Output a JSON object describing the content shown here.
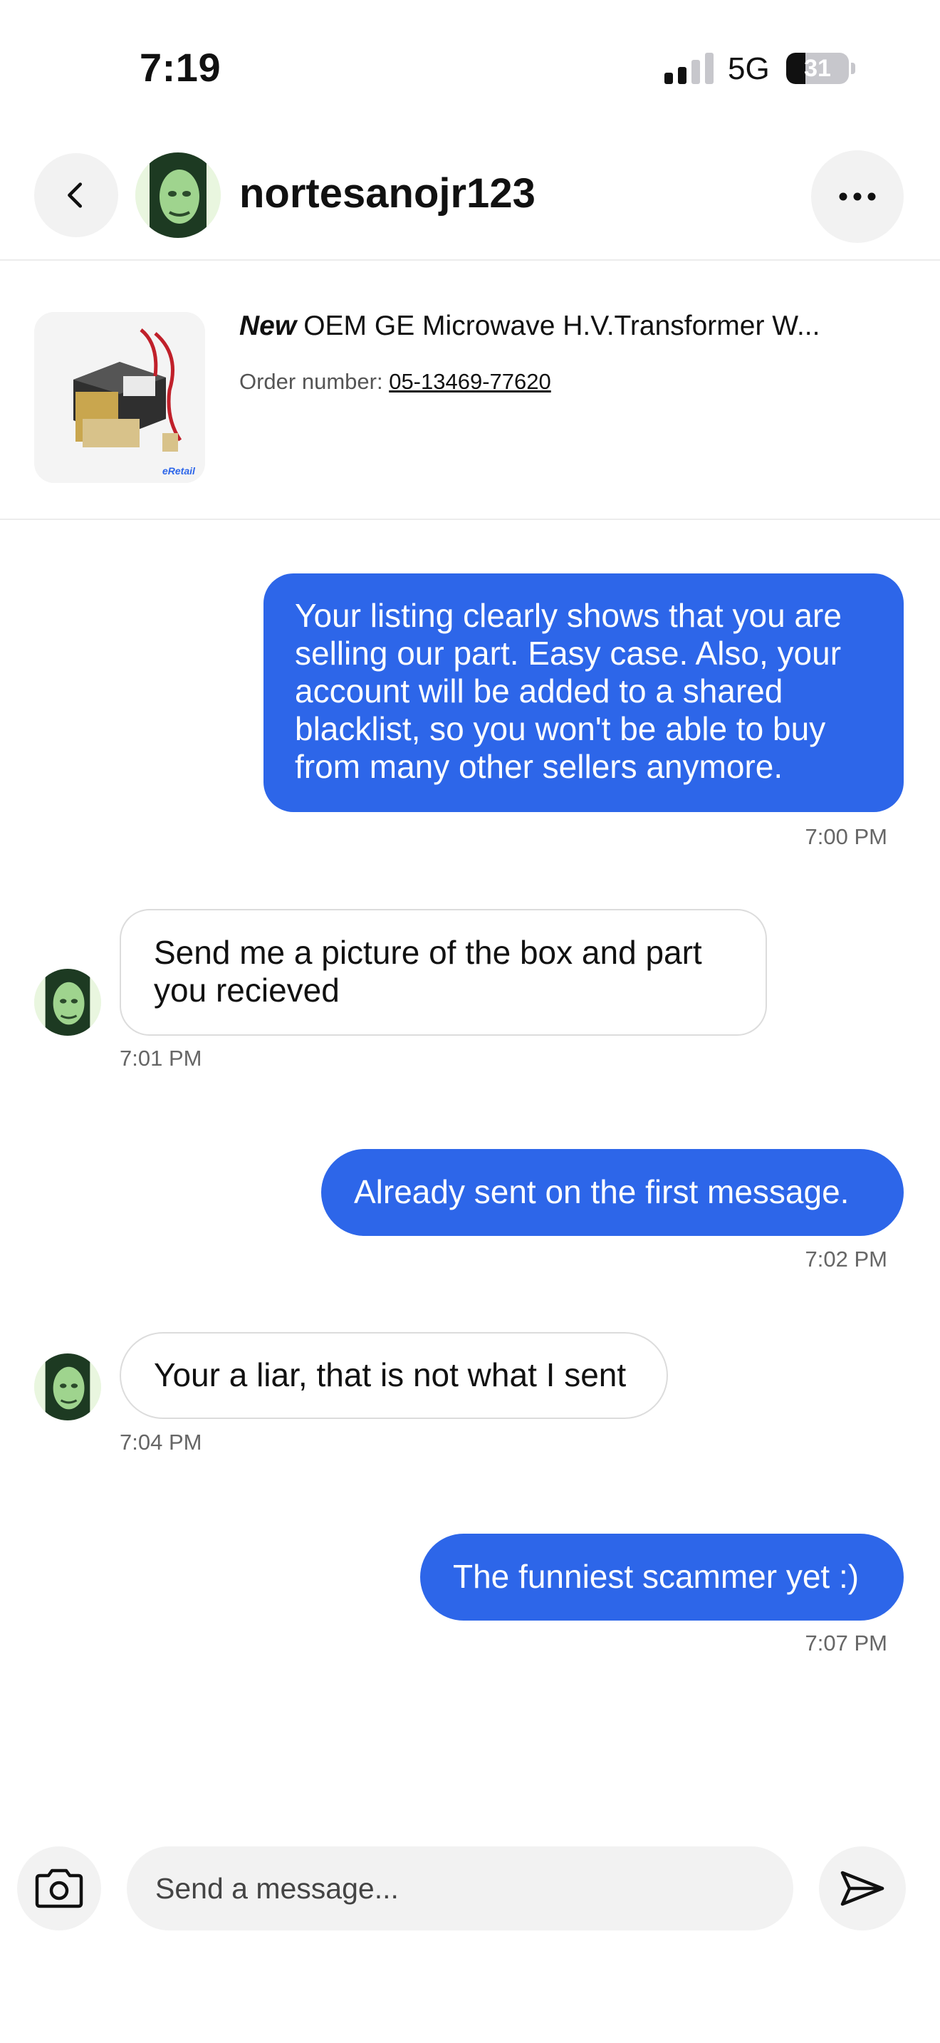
{
  "status_bar": {
    "time": "7:19",
    "network": "5G",
    "battery_percent": "31",
    "battery_level": 0.31,
    "signal_bars_active": 2,
    "signal_bars_total": 4
  },
  "header": {
    "username": "nortesanojr123",
    "back_icon": "chevron-left-icon",
    "more_icon": "ellipsis-icon"
  },
  "order": {
    "condition": "New",
    "title": "OEM GE Microwave H.V.Transformer W...",
    "order_label": "Order number:",
    "order_number": "05-13469-77620",
    "thumb_badge": "eRetail"
  },
  "messages": [
    {
      "direction": "outgoing",
      "lines": [
        "Your listing clearly shows that you are",
        "selling our part. Easy case. Also, your",
        "account will be added to a shared",
        "blacklist, so you won't be able to buy",
        "from many other sellers anymore."
      ],
      "time": "7:00 PM"
    },
    {
      "direction": "incoming",
      "lines": [
        "Send me a picture of the box and part",
        "you recieved"
      ],
      "time": "7:01 PM"
    },
    {
      "direction": "outgoing",
      "lines": [
        "Already sent on the first message."
      ],
      "time": "7:02 PM"
    },
    {
      "direction": "incoming",
      "lines": [
        "Your a liar, that is not what I sent"
      ],
      "time": "7:04 PM"
    },
    {
      "direction": "outgoing",
      "lines": [
        "The funniest scammer yet :)"
      ],
      "time": "7:07 PM"
    }
  ],
  "composer": {
    "placeholder": "Send a message...",
    "camera_icon": "camera-icon",
    "send_icon": "send-icon"
  },
  "colors": {
    "outgoing_bubble": "#2d66e9",
    "incoming_border": "#dcdcdc",
    "button_bg": "#f2f2f2"
  }
}
